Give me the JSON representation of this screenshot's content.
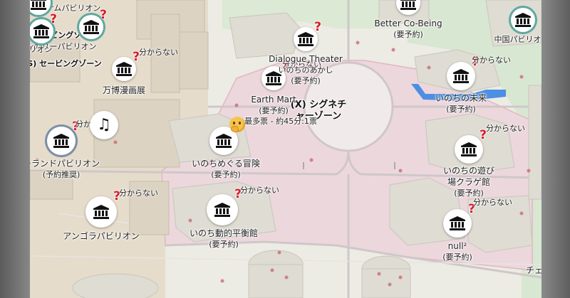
{
  "map": {
    "colors": {
      "pavilion_zone": "#ecd7dd",
      "pavilion_zone_border": "#e2b6c2",
      "ground": "#ecebe4",
      "green": "#d6e8cf",
      "building": "#dedcd3",
      "building_side": "#c9c6bb",
      "water": "#4c8fe3",
      "marker_badge": "#d8192b",
      "marker_ring": "#5fa8a0"
    },
    "zone_label": {
      "line1": "(X) シグネチ",
      "line2": "ャーゾーン"
    },
    "unknown_text": "分からない",
    "reservation_text": "(要予約)",
    "labels": {
      "earth_mart": "Earth Mart",
      "earth_mart_sub": "(要予約)",
      "most_votes": "最多票 - 約45分:1票",
      "inochi_meguru": "いのちめぐる冒険",
      "inochi_meguru_sub": "(要予約)",
      "inochi_doteki": "いのち動的平衡館",
      "inochi_doteki_sub": "(要予約)",
      "angola": "アンゴラパビリオン",
      "land": "ーランドパビリオン",
      "land_sub": "(予約推奨)",
      "manga": "万博漫画展",
      "seeding_zone": "(S) セービングゾーン",
      "seeding_zone_2": "セービングゾーン",
      "hungary": "ンガリーパビリオン",
      "pavilion_left": "パビリオン",
      "dialogue": "Dialogue Theater",
      "dialogue_sub": "いのちのあかし",
      "dialogue_sub2": "(要予約)",
      "better_cobeing": "Better Co-Being",
      "better_cobeing_sub": "(要予約)",
      "china": "中国パビリオン",
      "mirai": "いのちの未来",
      "mirai_sub": "(要予約)",
      "asobi": "いのちの遊び",
      "asobi_2": "場クラゲ館",
      "asobi_sub": "(要予約)",
      "null_label": "null²",
      "null_sub": "(要予約)",
      "che": "チェ",
      "top_cut": "ャトナムパビリオン"
    },
    "markers": [
      {
        "name": "earth-mart-marker",
        "icon": "museum-icon",
        "badge": "?"
      },
      {
        "name": "inochi-meguru-marker",
        "icon": "museum-icon",
        "badge": "thinking-face"
      },
      {
        "name": "inochi-doteki-marker",
        "icon": "museum-icon",
        "badge": "?"
      },
      {
        "name": "angola-marker",
        "icon": "museum-icon",
        "badge": "?"
      },
      {
        "name": "land-pavilion-marker",
        "icon": "museum-icon",
        "badge": "?"
      },
      {
        "name": "music-marker",
        "icon": "music-note-icon",
        "badge": ""
      },
      {
        "name": "manga-marker",
        "icon": "museum-icon",
        "badge": "?"
      },
      {
        "name": "dialogue-marker",
        "icon": "museum-icon",
        "badge": "?"
      },
      {
        "name": "better-cobeing-marker",
        "icon": "museum-icon",
        "badge": "?"
      },
      {
        "name": "china-marker",
        "icon": "museum-icon",
        "badge": "?"
      },
      {
        "name": "mirai-marker",
        "icon": "museum-icon",
        "badge": "?"
      },
      {
        "name": "asobi-marker",
        "icon": "museum-icon",
        "badge": "?"
      },
      {
        "name": "null-marker",
        "icon": "museum-icon",
        "badge": "?"
      },
      {
        "name": "seeding-marker-1",
        "icon": "museum-icon",
        "badge": "?"
      },
      {
        "name": "seeding-marker-2",
        "icon": "museum-icon",
        "badge": "?"
      },
      {
        "name": "top-left-marker",
        "icon": "museum-icon",
        "badge": "?"
      }
    ]
  }
}
